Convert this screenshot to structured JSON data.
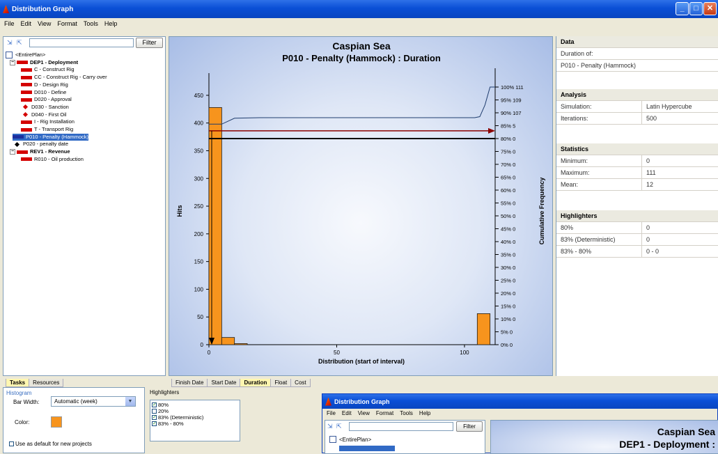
{
  "window": {
    "title": "Distribution Graph",
    "buttons": [
      "_",
      "□",
      "✕"
    ]
  },
  "menu": [
    "File",
    "Edit",
    "View",
    "Format",
    "Tools",
    "Help"
  ],
  "filter": {
    "button": "Filter",
    "placeholder": ""
  },
  "tree": [
    {
      "label": "<EntirePlan>",
      "icon": "plan-icon",
      "bold": false
    },
    {
      "label": "DEP1 - Deployment",
      "icon": "bar",
      "bold": true
    },
    {
      "label": "C - Construct Rig",
      "icon": "bar"
    },
    {
      "label": "CC - Construct Rig - Carry over",
      "icon": "bar"
    },
    {
      "label": "D - Design Rig",
      "icon": "bar"
    },
    {
      "label": "D010 - Define",
      "icon": "bar"
    },
    {
      "label": "D020 - Approval",
      "icon": "bar"
    },
    {
      "label": "D030 - Sanction",
      "icon": "diamond"
    },
    {
      "label": "D040 - First Oil",
      "icon": "diamond"
    },
    {
      "label": "I - Rig Installation",
      "icon": "bar"
    },
    {
      "label": "T - Transport Rig",
      "icon": "bar"
    },
    {
      "label": "P010 - Penalty (Hammock)",
      "icon": "bar-blue",
      "selected": true
    },
    {
      "label": "P020 - penalty date",
      "icon": "diamond-black"
    },
    {
      "label": "REV1 - Revenue",
      "icon": "bar",
      "bold": true
    },
    {
      "label": "R010 - Oil production",
      "icon": "bar"
    }
  ],
  "chart_data": {
    "type": "bar",
    "title": "Caspian Sea",
    "subtitle": "P010 - Penalty (Hammock) : Duration",
    "xlabel": "Distribution (start of interval)",
    "ylabel": "Hits",
    "y2label": "Cumulative Frequency",
    "xlim": [
      0,
      112
    ],
    "ylim": [
      0,
      480
    ],
    "x_ticks": [
      "0",
      "50",
      "100"
    ],
    "y_ticks": [
      "0",
      "50",
      "100",
      "150",
      "200",
      "250",
      "300",
      "350",
      "400",
      "450"
    ],
    "bars": [
      {
        "x": 0,
        "width": 5,
        "value": 428
      },
      {
        "x": 5,
        "width": 5,
        "value": 13
      },
      {
        "x": 10,
        "width": 5,
        "value": 2
      },
      {
        "x": 105,
        "width": 5,
        "value": 56
      }
    ],
    "cumulative": [
      [
        0,
        0.856
      ],
      [
        5,
        0.856
      ],
      [
        10,
        0.879
      ],
      [
        15,
        0.88
      ],
      [
        20,
        0.881
      ],
      [
        100,
        0.881
      ],
      [
        104,
        0.881
      ],
      [
        106,
        0.885
      ],
      [
        108,
        0.93
      ],
      [
        110,
        1.0
      ],
      [
        112,
        1.0
      ]
    ],
    "right_ticks": [
      "0% 0",
      "5% 0",
      "10% 0",
      "15% 0",
      "20% 0",
      "25% 0",
      "30% 0",
      "35% 0",
      "40% 0",
      "45% 0",
      "50% 0",
      "55% 0",
      "60% 0",
      "65% 0",
      "70% 0",
      "75% 0",
      "80% 0",
      "85% 5",
      "90% 107",
      "95% 109",
      "100% 111"
    ],
    "highlight_lines": [
      {
        "name": "83% (Deterministic)",
        "fraction": 0.83,
        "color": "#8b0000",
        "arrow": true
      },
      {
        "name": "80%",
        "fraction": 0.8,
        "color": "#000000",
        "arrow": false
      }
    ],
    "bar_color": "#f7941d",
    "line_color": "#1f3d6e"
  },
  "right_panel": {
    "data_head": "Data",
    "duration_of": "Duration of:",
    "duration_value": "P010 - Penalty (Hammock)",
    "analysis_head": "Analysis",
    "analysis": [
      [
        "Simulation:",
        "Latin Hypercube"
      ],
      [
        "Iterations:",
        "500"
      ]
    ],
    "statistics_head": "Statistics",
    "statistics": [
      [
        "Minimum:",
        "0"
      ],
      [
        "Maximum:",
        "111"
      ],
      [
        "Mean:",
        "12"
      ]
    ],
    "highlighters_head": "Highlighters",
    "highlighters": [
      [
        "80%",
        "0"
      ],
      [
        "83% (Deterministic)",
        "0"
      ],
      [
        "83% - 80%",
        "0 - 0"
      ]
    ]
  },
  "left_tabs": [
    "Tasks",
    "Resources"
  ],
  "chart_tabs": [
    "Finish Date",
    "Start Date",
    "Duration",
    "Float",
    "Cost"
  ],
  "props": {
    "histogram_label": "Histogram",
    "bar_width_label": "Bar Width:",
    "bar_width_value": "Automatic (week)",
    "color_label": "Color:",
    "color_value": "#f7941d",
    "default_label": "Use as default for new projects"
  },
  "highlighters_panel": {
    "label": "Highlighters",
    "items": [
      {
        "label": "80%",
        "checked": true
      },
      {
        "label": "20%",
        "checked": false
      },
      {
        "label": "83% (Deterministic)",
        "checked": true
      },
      {
        "label": "83% - 80%",
        "checked": true
      }
    ]
  },
  "sub_window": {
    "title": "Distribution Graph",
    "menu": [
      "File",
      "Edit",
      "View",
      "Format",
      "Tools",
      "Help"
    ],
    "filter": "Filter",
    "tree_item": "<EntirePlan>",
    "chart_title": "Caspian Sea",
    "chart_subtitle": "DEP1 - Deployment :"
  }
}
